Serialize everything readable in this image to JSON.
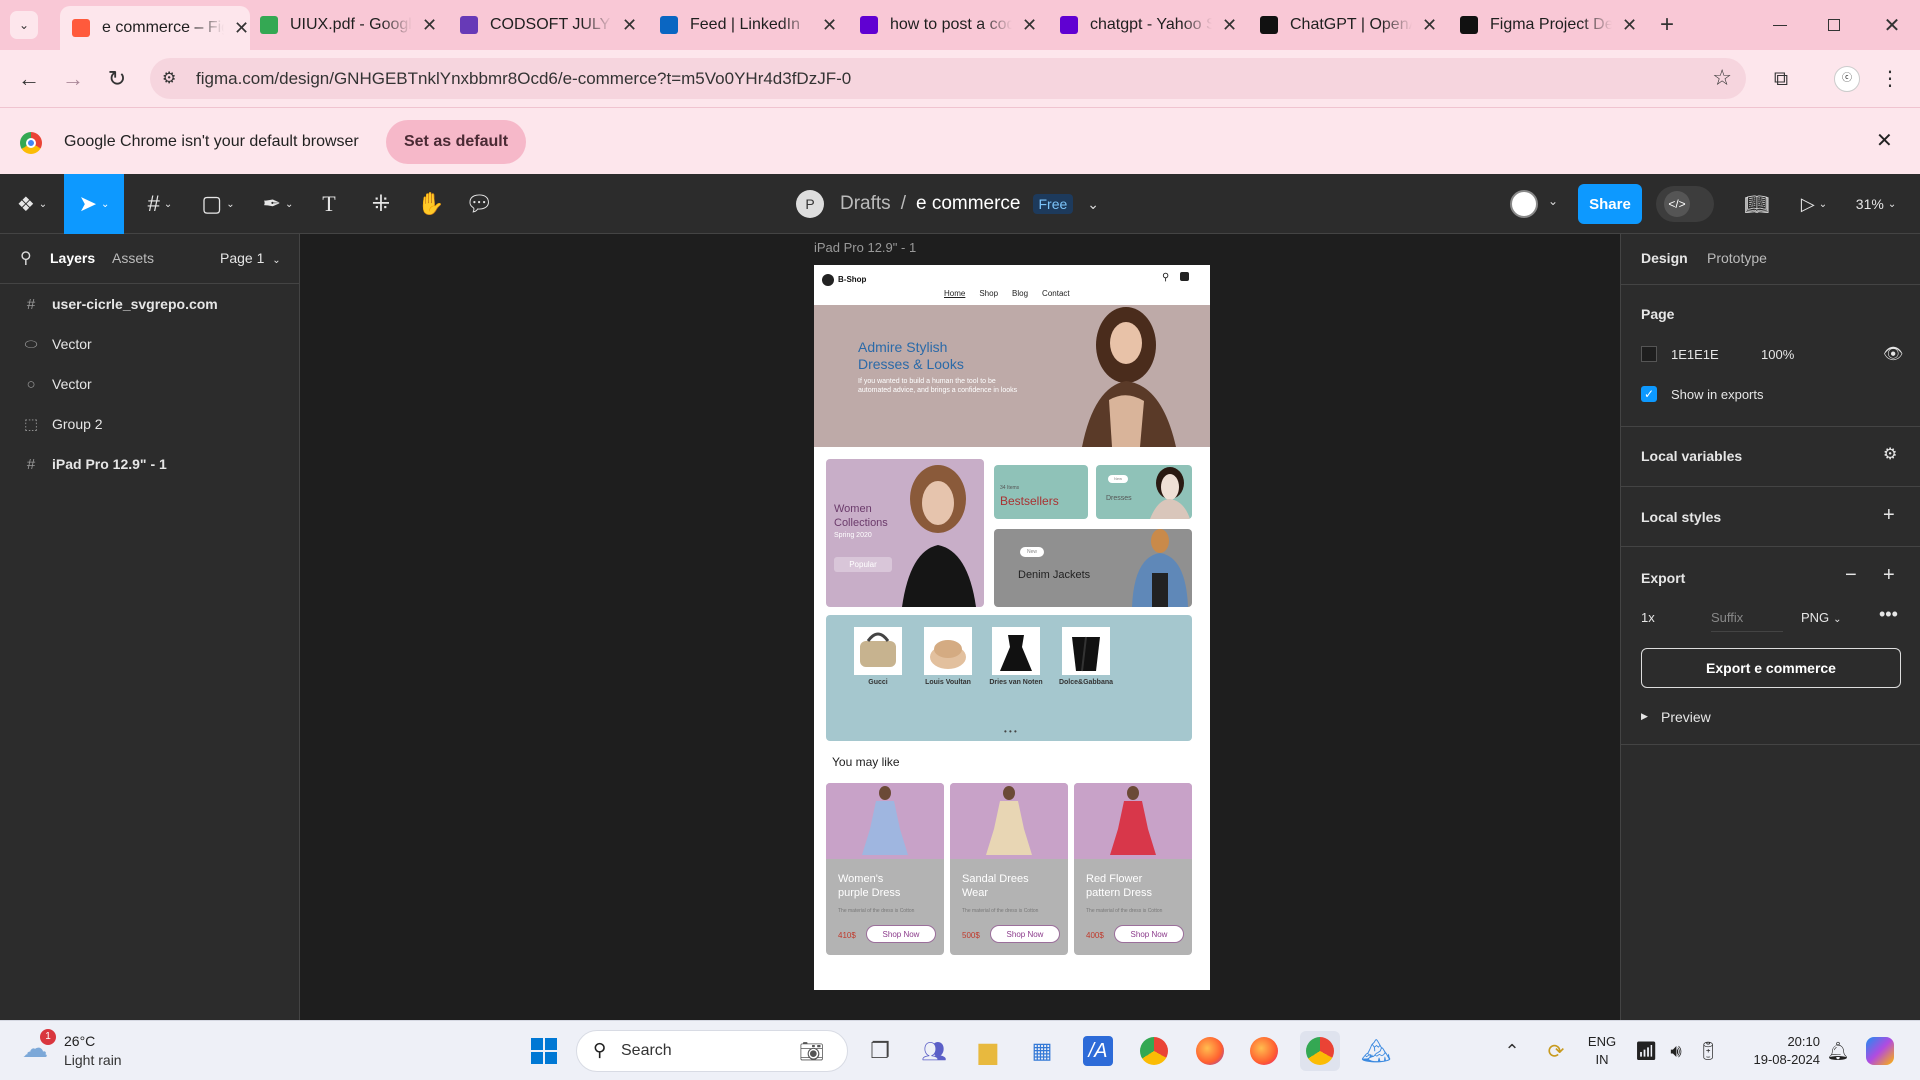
{
  "browser": {
    "tabs": [
      {
        "title": "e commerce – Figma",
        "icon": "figma-icon",
        "color": "#ff5a3c"
      },
      {
        "title": "UIUX.pdf - Google Drive",
        "icon": "drive-icon",
        "color": "#34a853"
      },
      {
        "title": "CODSOFT JULY TASKS",
        "icon": "forms-icon",
        "color": "#673ab7"
      },
      {
        "title": "Feed | LinkedIn",
        "icon": "linkedin-icon",
        "color": "#0a66c2"
      },
      {
        "title": "how to post a code",
        "icon": "yahoo-icon",
        "color": "#6001d2"
      },
      {
        "title": "chatgpt - Yahoo Search",
        "icon": "yahoo-icon",
        "color": "#6001d2"
      },
      {
        "title": "ChatGPT | OpenAI",
        "icon": "openai-icon",
        "color": "#111111"
      },
      {
        "title": "Figma Project Design",
        "icon": "openai-icon",
        "color": "#111111"
      }
    ],
    "url": "figma.com/design/GNHGEBTnklYnxbbmr8Ocd6/e-commerce?t=m5Vo0YHr4d3fDzJF-0",
    "infobar": {
      "message": "Google Chrome isn't your default browser",
      "button": "Set as default"
    },
    "profile_label": "ⓒ"
  },
  "figma": {
    "breadcrumb": {
      "avatar": "P",
      "folder": "Drafts",
      "separator": "/",
      "file": "e commerce",
      "badge": "Free"
    },
    "share": "Share",
    "zoom": "31%",
    "left_tabs": {
      "layers": "Layers",
      "assets": "Assets",
      "page": "Page 1"
    },
    "layers": [
      {
        "name": "user-cicrle_svgrepo.com",
        "icon": "#",
        "bold": true
      },
      {
        "name": "Vector",
        "icon": "⬭",
        "bold": false
      },
      {
        "name": "Vector",
        "icon": "○",
        "bold": false
      },
      {
        "name": "Group 2",
        "icon": "⬚",
        "bold": false
      },
      {
        "name": "iPad Pro 12.9\" - 1",
        "icon": "#",
        "bold": true
      }
    ],
    "right": {
      "tab_design": "Design",
      "tab_prototype": "Prototype",
      "page_title": "Page",
      "page_color": "1E1E1E",
      "page_opacity": "100%",
      "show_exports": "Show in exports",
      "local_variables": "Local variables",
      "local_styles": "Local styles",
      "export_title": "Export",
      "export_scale": "1x",
      "export_suffix": "Suffix",
      "export_format": "PNG",
      "export_button": "Export e commerce",
      "preview": "Preview"
    },
    "frame_label": "iPad Pro 12.9\" - 1",
    "help": "?"
  },
  "design": {
    "brand": "B-Shop",
    "nav": [
      "Home",
      "Shop",
      "Blog",
      "Contact"
    ],
    "hero_title_1": "Admire Stylish",
    "hero_title_2": "Dresses & Looks",
    "hero_body": "If you wanted to build a human the tool to be automated advice, and brings a confidence in looks",
    "women_title_1": "Women",
    "women_title_2": "Collections",
    "women_sub": "Spring 2020",
    "popular": "Popular",
    "best_small": "34 Items",
    "bestsellers": "Bestsellers",
    "dresses_badge": "New",
    "dresses": "Dresses",
    "denim_badge": "New",
    "denim": "Denim Jackets",
    "brands": [
      "Gucci",
      "Louis Voultan",
      "Dries van Noten",
      "Dolce&Gabbana"
    ],
    "may_like": "You may like",
    "products": [
      {
        "name1": "Women's",
        "name2": "purple  Dress",
        "desc": "The material of the dress is Cotton",
        "price": "410$",
        "button": "Shop Now",
        "dress_color": "#9fb6e0"
      },
      {
        "name1": "Sandal Drees",
        "name2": "Wear",
        "desc": "The material of the dress is Cotton",
        "price": "500$",
        "button": "Shop Now",
        "dress_color": "#e8d6b4"
      },
      {
        "name1": "Red Flower",
        "name2": "pattern Dress",
        "desc": "The material of the dress is Cotton",
        "price": "400$",
        "button": "Shop Now",
        "dress_color": "#d8374a"
      }
    ]
  },
  "taskbar": {
    "weather_temp": "26°C",
    "weather_desc": "Light rain",
    "weather_badge": "1",
    "search": "Search",
    "lang1": "ENG",
    "lang2": "IN",
    "time": "20:10",
    "date": "19-08-2024"
  }
}
